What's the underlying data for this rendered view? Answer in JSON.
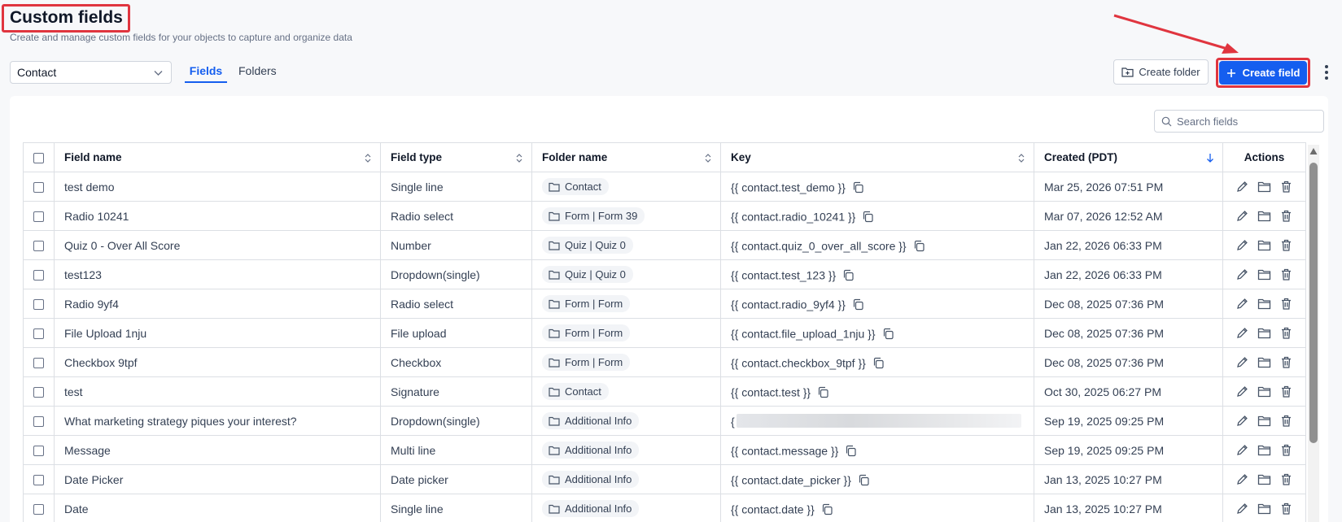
{
  "page": {
    "title": "Custom fields",
    "subtitle": "Create and manage custom fields for your objects to capture and organize data"
  },
  "toolbar": {
    "object_select_value": "Contact",
    "tabs": [
      {
        "label": "Fields",
        "active": true
      },
      {
        "label": "Folders",
        "active": false
      }
    ],
    "create_folder_label": "Create folder",
    "create_field_label": "Create field"
  },
  "search": {
    "placeholder": "Search fields"
  },
  "table": {
    "columns": [
      "Field name",
      "Field type",
      "Folder name",
      "Key",
      "Created (PDT)",
      "Actions"
    ],
    "rows": [
      {
        "name": "test demo",
        "type": "Single line",
        "folder": "Contact",
        "key": "{{ contact.test_demo }}",
        "created": "Mar 25, 2026 07:51 PM"
      },
      {
        "name": "Radio 10241",
        "type": "Radio select",
        "folder": "Form | Form 39",
        "key": "{{ contact.radio_10241 }}",
        "created": "Mar 07, 2026 12:52 AM"
      },
      {
        "name": "Quiz 0 - Over All Score",
        "type": "Number",
        "folder": "Quiz | Quiz 0",
        "key": "{{ contact.quiz_0_over_all_score }}",
        "created": "Jan 22, 2026 06:33 PM"
      },
      {
        "name": "test123",
        "type": "Dropdown(single)",
        "folder": "Quiz | Quiz 0",
        "key": "{{ contact.test_123 }}",
        "created": "Jan 22, 2026 06:33 PM"
      },
      {
        "name": "Radio 9yf4",
        "type": "Radio select",
        "folder": "Form | Form",
        "key": "{{ contact.radio_9yf4 }}",
        "created": "Dec 08, 2025 07:36 PM"
      },
      {
        "name": "File Upload 1nju",
        "type": "File upload",
        "folder": "Form | Form",
        "key": "{{ contact.file_upload_1nju }}",
        "created": "Dec 08, 2025 07:36 PM"
      },
      {
        "name": "Checkbox 9tpf",
        "type": "Checkbox",
        "folder": "Form | Form",
        "key": "{{ contact.checkbox_9tpf }}",
        "created": "Dec 08, 2025 07:36 PM"
      },
      {
        "name": "test",
        "type": "Signature",
        "folder": "Contact",
        "key": "{{ contact.test }}",
        "created": "Oct 30, 2025 06:27 PM"
      },
      {
        "name": "What marketing strategy piques your interest?",
        "type": "Dropdown(single)",
        "folder": "Additional Info",
        "key": "{",
        "key_redacted": true,
        "created": "Sep 19, 2025 09:25 PM"
      },
      {
        "name": "Message",
        "type": "Multi line",
        "folder": "Additional Info",
        "key": "{{ contact.message }}",
        "created": "Sep 19, 2025 09:25 PM"
      },
      {
        "name": "Date Picker",
        "type": "Date picker",
        "folder": "Additional Info",
        "key": "{{ contact.date_picker }}",
        "created": "Jan 13, 2025 10:27 PM"
      },
      {
        "name": "Date",
        "type": "Single line",
        "folder": "Additional Info",
        "key": "{{ contact.date }}",
        "created": "Jan 13, 2025 10:27 PM"
      }
    ]
  },
  "colors": {
    "accent": "#155eef",
    "highlight": "#e0353f",
    "background": "#f7f8fa"
  },
  "icons": [
    "chevron-down-icon",
    "folder-plus-icon",
    "plus-icon",
    "kebab-icon",
    "search-icon",
    "sort-icon",
    "sort-desc-icon",
    "folder-icon",
    "copy-icon",
    "edit-icon",
    "move-folder-icon",
    "trash-icon"
  ]
}
